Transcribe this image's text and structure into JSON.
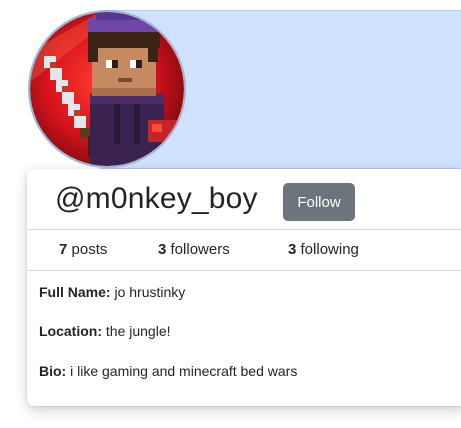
{
  "profile": {
    "username": "@m0nkey_boy",
    "follow_label": "Follow",
    "avatar_icon": "minecraft-skin-avatar",
    "banner_color": "#cfe2ff"
  },
  "stats": {
    "posts": {
      "count": "7",
      "label": "posts"
    },
    "followers": {
      "count": "3",
      "label": "followers"
    },
    "following": {
      "count": "3",
      "label": "following"
    }
  },
  "details": {
    "full_name_label": "Full Name:",
    "full_name": "jo hrustinky",
    "location_label": "Location:",
    "location": "the jungle!",
    "bio_label": "Bio:",
    "bio": "i like gaming and minecraft bed wars"
  }
}
